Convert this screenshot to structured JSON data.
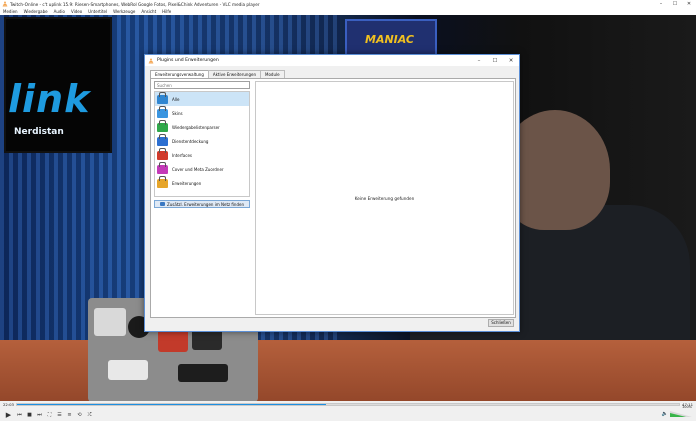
{
  "window": {
    "title": "Twitch-Online - c't uplink 15.9: Riesen-Smartphones, WebRol Google Fotos, Pixel&Chink Adventuren - VLC media player",
    "icon": "vlc-cone-icon",
    "controls": [
      "–",
      "☐",
      "✕"
    ]
  },
  "menu": [
    "Medien",
    "Wiedergabe",
    "Audio",
    "Video",
    "Untertitel",
    "Werkzeuge",
    "Ansicht",
    "Hilfe"
  ],
  "video": {
    "tv_text": "link",
    "tv_subtext": "Nerdistan",
    "poster_text": "MANIAC"
  },
  "dialog": {
    "title": "Plugins und Erweiterungen",
    "controls": [
      "–",
      "☐",
      "✕"
    ],
    "tabs": [
      "Erweiterungsverwaltung",
      "Aktive Erweiterungen",
      "Module"
    ],
    "search_placeholder": "Suchen",
    "categories": [
      {
        "label": "Alle",
        "color": "#2f86d1"
      },
      {
        "label": "Skins",
        "color": "#3a95e0"
      },
      {
        "label": "Wiedergabelistenparser",
        "color": "#2fa84a"
      },
      {
        "label": "Dienstentdeckung",
        "color": "#2c6fd1"
      },
      {
        "label": "Interfaces",
        "color": "#d13a2c"
      },
      {
        "label": "Cover und Meta Zuordner",
        "color": "#c43ab8"
      },
      {
        "label": "Erweiterungen",
        "color": "#e6a52a"
      }
    ],
    "find_button": "Zusätzl. Erweiterungen im Netz finden",
    "empty_message": "Keine Erweiterung gefunden",
    "close_button": "Schließen"
  },
  "player": {
    "time_elapsed": "22:03",
    "time_total": "47:11",
    "progress": 0.467,
    "volume_label": "100%",
    "volume": 0.72,
    "buttons": [
      "play",
      "prev",
      "stop",
      "next",
      "fullscreen",
      "extended",
      "playlist",
      "loop",
      "shuffle"
    ]
  }
}
